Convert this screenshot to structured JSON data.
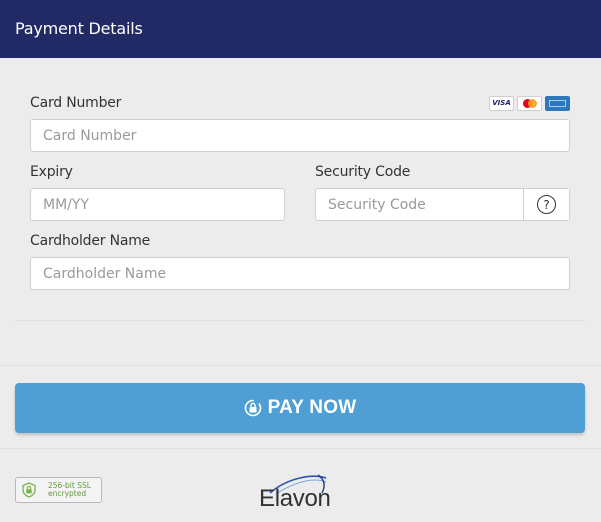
{
  "header": {
    "title": "Payment Details"
  },
  "form": {
    "card_number": {
      "label": "Card Number",
      "placeholder": "Card Number"
    },
    "accepted_cards": [
      {
        "name": "visa-icon",
        "text": "VISA"
      },
      {
        "name": "mastercard-icon"
      },
      {
        "name": "amex-icon"
      }
    ],
    "expiry": {
      "label": "Expiry",
      "placeholder": "MM/YY"
    },
    "security_code": {
      "label": "Security Code",
      "placeholder": "Security Code",
      "help_symbol": "?"
    },
    "cardholder": {
      "label": "Cardholder Name",
      "placeholder": "Cardholder Name"
    }
  },
  "pay_button": {
    "label": "PAY NOW"
  },
  "footer": {
    "ssl_badge": "256-bit SSL encrypted",
    "brand": "Elavon"
  },
  "colors": {
    "header_bg": "#222a66",
    "pay_button_bg": "#4f9fd4",
    "ssl_green": "#5d9a3a"
  }
}
